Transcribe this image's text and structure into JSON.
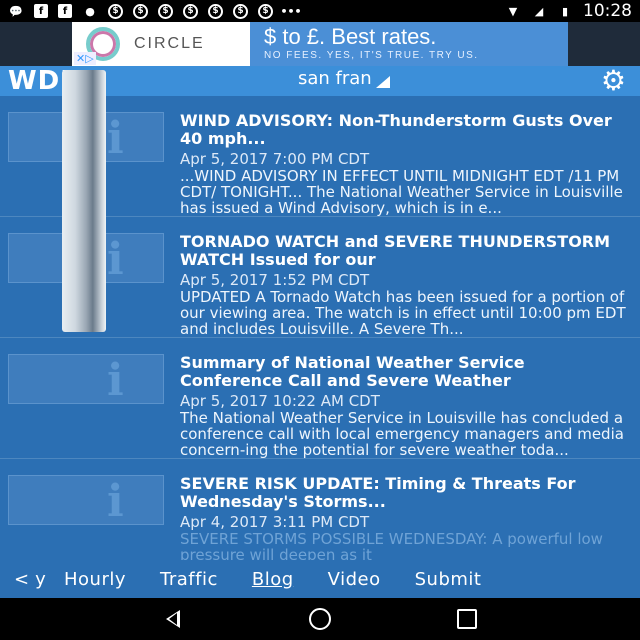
{
  "status_bar": {
    "time": "10:28",
    "icons": [
      "message-icon",
      "facebook-icon",
      "facebook-icon",
      "keyhole-icon",
      "dollar-icon",
      "dollar-icon",
      "dollar-icon",
      "dollar-icon",
      "dollar-icon",
      "dollar-icon",
      "dollar-icon",
      "dots-icon",
      "wifi-icon",
      "signal-icon",
      "battery-icon"
    ]
  },
  "ad": {
    "brand": "CIRCLE",
    "headline": "$ to £. Best rates.",
    "subline": "NO FEES. YES, IT'S TRUE. TRY US.",
    "close_label": "✕▷"
  },
  "header": {
    "logo": "WDRB",
    "location": "san fran",
    "settings_icon": "gear-icon"
  },
  "news": [
    {
      "title": "WIND ADVISORY: Non-Thunderstorm Gusts Over 40 mph...",
      "date": "Apr 5, 2017 7:00 PM CDT",
      "summary": "...WIND ADVISORY IN EFFECT UNTIL MIDNIGHT EDT /11 PM CDT/ TONIGHT... The National Weather Service in Louisville has issued a Wind Advisory, which is in e..."
    },
    {
      "title": "TORNADO WATCH and SEVERE THUNDERSTORM WATCH Issued for our",
      "date": "Apr 5, 2017 1:52 PM CDT",
      "summary": "UPDATED A Tornado Watch has been issued for a portion of our viewing area. The watch is in effect until 10:00 pm EDT and includes Louisville. A Severe Th..."
    },
    {
      "title": "Summary of National Weather Service Conference Call and Severe Weather",
      "date": "Apr 5, 2017 10:22 AM CDT",
      "summary": "The National Weather Service in Louisville has concluded a conference call with local emergency managers and media concern-ing the potential for severe weather toda..."
    },
    {
      "title": "SEVERE RISK UPDATE: Timing & Threats For Wednesday's Storms...",
      "date": "Apr 4, 2017 3:11 PM CDT",
      "summary": "SEVERE STORMS POSSIBLE WEDNESDAY: A powerful low pressure will deepen as it"
    }
  ],
  "bottom_nav": {
    "back_label": "<",
    "partial_label": "y",
    "items": [
      "Hourly",
      "Traffic",
      "Blog",
      "Video",
      "Submit"
    ],
    "active": "Blog"
  }
}
